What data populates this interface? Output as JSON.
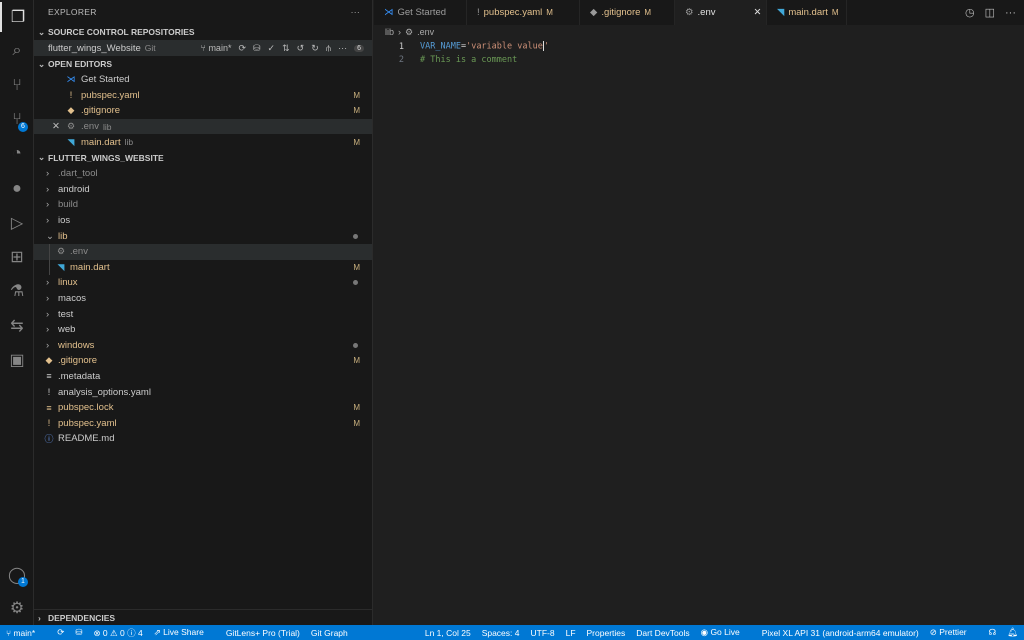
{
  "activity": [
    {
      "icon": "files-icon"
    },
    {
      "icon": "search-icon"
    },
    {
      "icon": "source-control-icon"
    },
    {
      "icon": "source-control-badge-icon",
      "badge": "6"
    },
    {
      "icon": "gitlens-icon"
    },
    {
      "icon": "github-icon"
    },
    {
      "icon": "run-debug-icon"
    },
    {
      "icon": "extensions-icon"
    },
    {
      "icon": "testing-icon"
    },
    {
      "icon": "remote-icon"
    },
    {
      "icon": "device-icon"
    }
  ],
  "account_badge": "1",
  "explorer": {
    "title": "EXPLORER",
    "more": "···",
    "scm_title": "SOURCE CONTROL REPOSITORIES",
    "repo": {
      "name": "flutter_wings_Website",
      "type": "Git",
      "branch": "main*",
      "count": "6"
    },
    "open_editors_title": "OPEN EDITORS",
    "open_editors": [
      {
        "name": "Get Started",
        "sub": "",
        "status": "",
        "color": "w",
        "icon": "⋊"
      },
      {
        "name": "pubspec.yaml",
        "sub": "",
        "status": "M",
        "color": "y",
        "icon": "!"
      },
      {
        "name": ".gitignore",
        "sub": "",
        "status": "M",
        "color": "y",
        "icon": "◆"
      },
      {
        "name": ".env",
        "sub": "lib",
        "status": "",
        "color": "g",
        "icon": "⚙"
      },
      {
        "name": "main.dart",
        "sub": "lib",
        "status": "M",
        "color": "y",
        "icon": "◥"
      }
    ],
    "project_title": "FLUTTER_WINGS_WEBSITE",
    "tree": [
      {
        "name": ".dart_tool",
        "type": "folder",
        "color": "g",
        "status": ""
      },
      {
        "name": "android",
        "type": "folder",
        "color": "w",
        "status": ""
      },
      {
        "name": "build",
        "type": "folder",
        "color": "g",
        "status": ""
      },
      {
        "name": "ios",
        "type": "folder",
        "color": "w",
        "status": ""
      },
      {
        "name": "lib",
        "type": "open",
        "color": "y",
        "status": "dot"
      },
      {
        "name": ".env",
        "type": "file",
        "color": "g",
        "status": "",
        "icon": "⚙",
        "indent": 1,
        "selected": true
      },
      {
        "name": "main.dart",
        "type": "file",
        "color": "y",
        "status": "M",
        "icon": "◥",
        "indent": 1
      },
      {
        "name": "linux",
        "type": "folder",
        "color": "y",
        "status": "dot"
      },
      {
        "name": "macos",
        "type": "folder",
        "color": "w",
        "status": ""
      },
      {
        "name": "test",
        "type": "folder",
        "color": "w",
        "status": ""
      },
      {
        "name": "web",
        "type": "folder",
        "color": "w",
        "status": ""
      },
      {
        "name": "windows",
        "type": "folder",
        "color": "y",
        "status": "dot"
      },
      {
        "name": ".gitignore",
        "type": "file",
        "color": "y",
        "status": "M",
        "icon": "◆"
      },
      {
        "name": ".metadata",
        "type": "file",
        "color": "w",
        "status": "",
        "icon": "≡"
      },
      {
        "name": "analysis_options.yaml",
        "type": "file",
        "color": "w",
        "status": "",
        "icon": "!"
      },
      {
        "name": "pubspec.lock",
        "type": "file",
        "color": "y",
        "status": "M",
        "icon": "≡"
      },
      {
        "name": "pubspec.yaml",
        "type": "file",
        "color": "y",
        "status": "M",
        "icon": "!"
      },
      {
        "name": "README.md",
        "type": "file",
        "color": "w",
        "status": "",
        "icon": "ⓘ"
      }
    ],
    "dependencies_title": "DEPENDENCIES"
  },
  "tabs": [
    {
      "label": "Get Started",
      "status": "",
      "icon": "⋊"
    },
    {
      "label": "pubspec.yaml",
      "status": "M",
      "icon": "!"
    },
    {
      "label": ".gitignore",
      "status": "M",
      "icon": "◆"
    },
    {
      "label": ".env",
      "status": "",
      "icon": "⚙",
      "active": true,
      "close": "✕"
    },
    {
      "label": "main.dart",
      "status": "M",
      "icon": "◥"
    }
  ],
  "breadcrumb": {
    "folder": "lib",
    "file": ".env"
  },
  "code": {
    "line1_num": "1",
    "line1_key": "VAR_NAME",
    "line1_eq": "=",
    "line1_val": "'variable value",
    "line1_end": "'",
    "line2_num": "2",
    "line2_comment": "# This is a comment"
  },
  "status": {
    "branch": "main*",
    "problems": "⊗ 0 ⚠ 0 ⓘ 4",
    "live_share": "Live Share",
    "gitlens": "GitLens+ Pro (Trial)",
    "git_graph": "Git Graph",
    "position": "Ln 1, Col 25",
    "spaces": "Spaces: 4",
    "encoding": "UTF-8",
    "eol": "LF",
    "language": "Properties",
    "devtools": "Dart DevTools",
    "go_live": "Go Live",
    "device": "Pixel XL API 31 (android-arm64 emulator)",
    "prettier": "Prettier"
  },
  "colors": {
    "accent": "#0078d4",
    "modified": "#e2c08d"
  }
}
